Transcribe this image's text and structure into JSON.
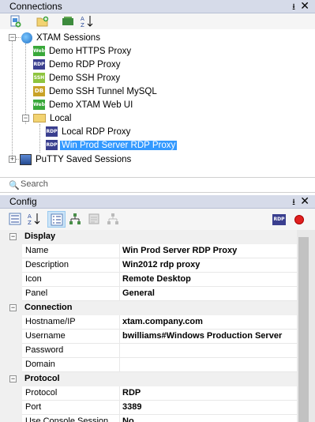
{
  "connections_panel": {
    "title": "Connections",
    "pin_glyph": "⭳",
    "close_glyph": "✕"
  },
  "tree": {
    "root": "XTAM Sessions",
    "items": [
      {
        "label": "Demo HTTPS Proxy",
        "badge": "Web"
      },
      {
        "label": "Demo RDP Proxy",
        "badge": "RDP"
      },
      {
        "label": "Demo SSH Proxy",
        "badge": "SSH"
      },
      {
        "label": "Demo SSH Tunnel MySQL",
        "badge": "DB"
      },
      {
        "label": "Demo XTAM Web UI",
        "badge": "Web"
      }
    ],
    "folder": "Local",
    "folder_items": [
      {
        "label": "Local RDP Proxy",
        "badge": "RDP"
      },
      {
        "label": "Win Prod Server RDP Proxy",
        "badge": "RDP"
      }
    ],
    "putty": "PuTTY Saved Sessions"
  },
  "search": {
    "placeholder": "Search"
  },
  "config_panel": {
    "title": "Config",
    "pin_glyph": "⭳",
    "close_glyph": "✕",
    "rdp_badge": "RDP"
  },
  "properties": {
    "display": {
      "category": "Display",
      "rows": [
        {
          "name": "Name",
          "value": "Win Prod Server RDP Proxy"
        },
        {
          "name": "Description",
          "value": "Win2012 rdp proxy"
        },
        {
          "name": "Icon",
          "value": "Remote Desktop"
        },
        {
          "name": "Panel",
          "value": "General"
        }
      ]
    },
    "connection": {
      "category": "Connection",
      "rows": [
        {
          "name": "Hostname/IP",
          "value": "xtam.company.com"
        },
        {
          "name": "Username",
          "value": "bwilliams#Windows Production Server"
        },
        {
          "name": "Password",
          "value": ""
        },
        {
          "name": "Domain",
          "value": ""
        }
      ]
    },
    "protocol": {
      "category": "Protocol",
      "rows": [
        {
          "name": "Protocol",
          "value": "RDP"
        },
        {
          "name": "Port",
          "value": "3389"
        },
        {
          "name": "Use Console Session",
          "value": "No"
        }
      ]
    }
  },
  "colors": {
    "header_bg": "#d6dbe9",
    "selection": "#3399ff",
    "rdp_badge": "#3a3f8f",
    "web_badge": "#39a83a",
    "ssh_badge": "#8ec43e"
  }
}
